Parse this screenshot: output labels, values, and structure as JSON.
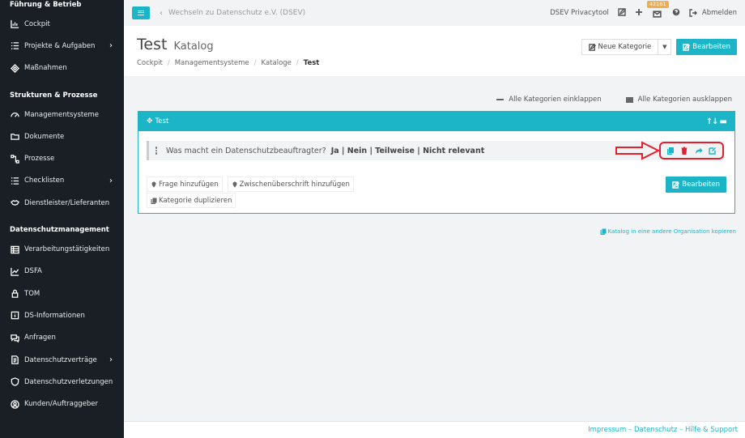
{
  "sidebar": {
    "sections": [
      {
        "heading": "Führung & Betrieb",
        "items": [
          {
            "label": "Cockpit",
            "icon": "chart-icon",
            "chevron": false
          },
          {
            "label": "Projekte & Aufgaben",
            "icon": "list-icon",
            "chevron": true
          },
          {
            "label": "Maßnahmen",
            "icon": "diamond-icon",
            "chevron": false
          }
        ]
      },
      {
        "heading": "Strukturen & Prozesse",
        "items": [
          {
            "label": "Managementsysteme",
            "icon": "gauge-icon",
            "chevron": false
          },
          {
            "label": "Dokumente",
            "icon": "folder-icon",
            "chevron": false
          },
          {
            "label": "Prozesse",
            "icon": "process-icon",
            "chevron": false
          },
          {
            "label": "Checklisten",
            "icon": "checklist-icon",
            "chevron": true
          },
          {
            "label": "Dienstleister/Lieferanten",
            "icon": "handshake-icon",
            "chevron": false
          }
        ]
      },
      {
        "heading": "Datenschutzmanagement",
        "items": [
          {
            "label": "Verarbeitungstätigkeiten",
            "icon": "table-icon",
            "chevron": false
          },
          {
            "label": "DSFA",
            "icon": "trend-icon",
            "chevron": false
          },
          {
            "label": "TOM",
            "icon": "lock-icon",
            "chevron": false
          },
          {
            "label": "DS-Informationen",
            "icon": "info-icon",
            "chevron": false
          },
          {
            "label": "Anfragen",
            "icon": "chat-icon",
            "chevron": false
          },
          {
            "label": "Datenschutzverträge",
            "icon": "contract-icon",
            "chevron": true
          },
          {
            "label": "Datenschutzverletzungen",
            "icon": "shield-icon",
            "chevron": false
          },
          {
            "label": "Kunden/Auftraggeber",
            "icon": "user-icon",
            "chevron": false
          }
        ]
      }
    ]
  },
  "topbar": {
    "back_label": "Wechseln zu Datenschutz e.V. (DSEV)",
    "org_name": "DSEV Privacytool",
    "notification_count": "42161",
    "logout_label": "Abmelden"
  },
  "header": {
    "title": "Test",
    "subtitle": "Katalog",
    "breadcrumb": [
      "Cockpit",
      "Managementsysteme",
      "Kataloge",
      "Test"
    ],
    "new_category_label": "Neue Kategorie",
    "edit_label": "Bearbeiten"
  },
  "collapse": {
    "collapse_all_label": "Alle Kategorien einklappen",
    "expand_all_label": "Alle Kategorien ausklappen"
  },
  "category": {
    "title": "Test",
    "question": {
      "text": "Was macht ein Datenschutzbeauftragter?",
      "answers": "Ja | Nein | Teilweise | Nicht relevant"
    },
    "add_question_label": "Frage hinzufügen",
    "add_subheading_label": "Zwischenüberschrift hinzufügen",
    "duplicate_label": "Kategorie duplizieren",
    "edit_label": "Bearbeiten"
  },
  "copy_catalog_label": "Katalog in eine andere Organisation kopieren",
  "footer": {
    "text": "Impressum – Datenschutz – Hilfe & Support"
  },
  "colors": {
    "accent": "#1cb5c7",
    "sidebar_bg": "#1a1f25",
    "highlight": "#e0212e",
    "badge": "#f0ad4e"
  }
}
